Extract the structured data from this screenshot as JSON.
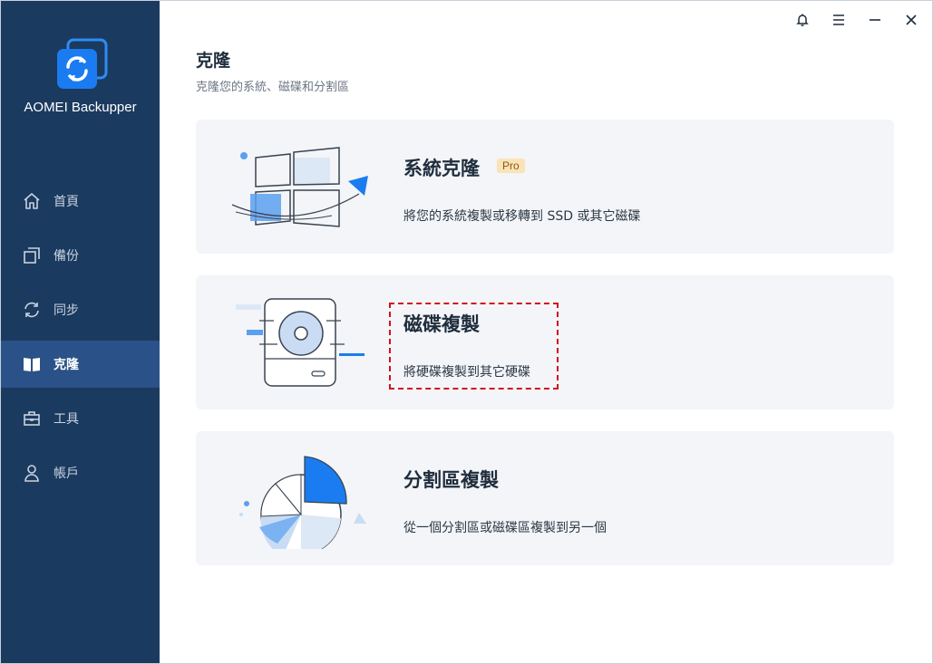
{
  "app": {
    "name": "AOMEI Backupper"
  },
  "sidebar": {
    "items": [
      {
        "label": "首頁",
        "icon": "home-icon"
      },
      {
        "label": "備份",
        "icon": "backup-icon"
      },
      {
        "label": "同步",
        "icon": "sync-icon"
      },
      {
        "label": "克隆",
        "icon": "clone-icon",
        "active": true
      },
      {
        "label": "工具",
        "icon": "toolbox-icon"
      },
      {
        "label": "帳戶",
        "icon": "user-icon"
      }
    ]
  },
  "titlebar": {
    "icons": [
      "bell-icon",
      "menu-icon",
      "minimize-icon",
      "close-icon"
    ]
  },
  "page": {
    "title": "克隆",
    "subtitle": "克隆您的系統、磁碟和分割區"
  },
  "cards": [
    {
      "title": "系統克隆",
      "badge": "Pro",
      "description": "將您的系統複製或移轉到 SSD 或其它磁碟"
    },
    {
      "title": "磁碟複製",
      "description": "將硬碟複製到其它硬碟",
      "highlighted": true
    },
    {
      "title": "分割區複製",
      "description": "從一個分割區或磁碟區複製到另一個"
    }
  ],
  "colors": {
    "sidebar_bg": "#1b3a5f",
    "sidebar_active": "#2a5289",
    "accent": "#1a7cf0",
    "card_bg": "#f3f5f8",
    "highlight_border": "#d0121e"
  }
}
